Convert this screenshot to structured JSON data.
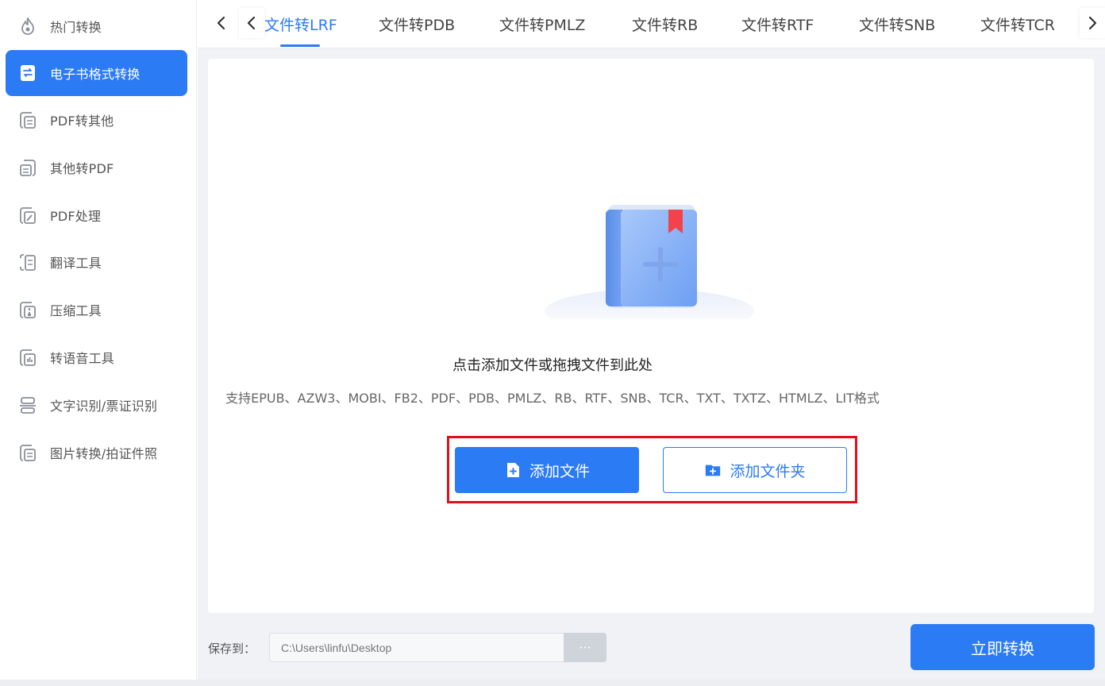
{
  "sidebar": {
    "items": [
      {
        "label": "热门转换",
        "icon": "fire-icon",
        "active": false
      },
      {
        "label": "电子书格式转换",
        "icon": "ebook-icon",
        "active": true
      },
      {
        "label": "PDF转其他",
        "icon": "pdf-to-other-icon",
        "active": false
      },
      {
        "label": "其他转PDF",
        "icon": "other-to-pdf-icon",
        "active": false
      },
      {
        "label": "PDF处理",
        "icon": "pdf-edit-icon",
        "active": false
      },
      {
        "label": "翻译工具",
        "icon": "translate-icon",
        "active": false
      },
      {
        "label": "压缩工具",
        "icon": "compress-icon",
        "active": false
      },
      {
        "label": "转语音工具",
        "icon": "audio-icon",
        "active": false
      },
      {
        "label": "文字识别/票证识别",
        "icon": "ocr-icon",
        "active": false
      },
      {
        "label": "图片转换/拍证件照",
        "icon": "image-icon",
        "active": false
      }
    ]
  },
  "tabs": [
    {
      "label": "文件转LRF",
      "active": true
    },
    {
      "label": "文件转PDB",
      "active": false
    },
    {
      "label": "文件转PMLZ",
      "active": false
    },
    {
      "label": "文件转RB",
      "active": false
    },
    {
      "label": "文件转RTF",
      "active": false
    },
    {
      "label": "文件转SNB",
      "active": false
    },
    {
      "label": "文件转TCR",
      "active": false
    }
  ],
  "dropzone": {
    "title": "点击添加文件或拖拽文件到此处",
    "supported": "支持EPUB、AZW3、MOBI、FB2、PDF、PDB、PMLZ、RB、RTF、SNB、TCR、TXT、TXTZ、HTMLZ、LIT格式",
    "add_file_label": "添加文件",
    "add_folder_label": "添加文件夹"
  },
  "footer": {
    "save_label": "保存到：",
    "save_path": "C:\\Users\\linfu\\Desktop",
    "browse_label": "···",
    "convert_label": "立即转换"
  },
  "colors": {
    "accent": "#2b7bf5",
    "highlight": "#e0101b"
  }
}
